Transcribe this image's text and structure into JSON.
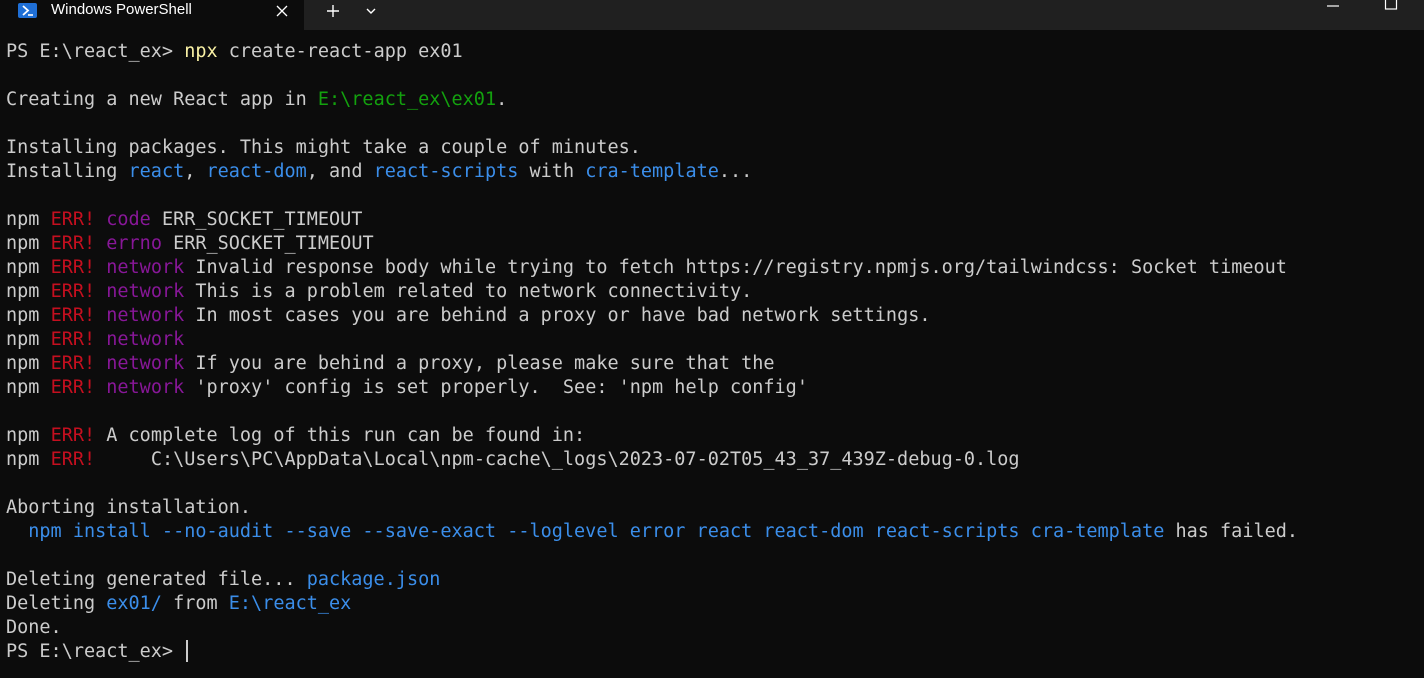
{
  "window": {
    "tab_title": "Windows PowerShell",
    "new_tab_icon": "plus-icon",
    "dropdown_icon": "chevron-down-icon",
    "close_icon": "close-icon"
  },
  "colors": {
    "background": "#0c0c0c",
    "text": "#cccccc",
    "yellow": "#f9f1a5",
    "green": "#13a10e",
    "blue": "#3b8eea",
    "red": "#c50f1f",
    "magenta": "#881798"
  },
  "terminal": {
    "lines": [
      {
        "segs": [
          {
            "t": "PS E:\\react_ex> ",
            "c": ""
          },
          {
            "t": "npx",
            "c": "yellow"
          },
          {
            "t": " create-react-app ex01",
            "c": ""
          }
        ]
      },
      {
        "segs": []
      },
      {
        "segs": [
          {
            "t": "Creating a new React app in ",
            "c": ""
          },
          {
            "t": "E:\\react_ex\\ex01",
            "c": "green"
          },
          {
            "t": ".",
            "c": ""
          }
        ]
      },
      {
        "segs": []
      },
      {
        "segs": [
          {
            "t": "Installing packages. This might take a couple of minutes.",
            "c": ""
          }
        ]
      },
      {
        "segs": [
          {
            "t": "Installing ",
            "c": ""
          },
          {
            "t": "react",
            "c": "blue"
          },
          {
            "t": ", ",
            "c": ""
          },
          {
            "t": "react-dom",
            "c": "blue"
          },
          {
            "t": ", and ",
            "c": ""
          },
          {
            "t": "react-scripts",
            "c": "blue"
          },
          {
            "t": " with ",
            "c": ""
          },
          {
            "t": "cra-template",
            "c": "blue"
          },
          {
            "t": "...",
            "c": ""
          }
        ]
      },
      {
        "segs": []
      },
      {
        "segs": [
          {
            "t": "npm ",
            "c": ""
          },
          {
            "t": "ERR!",
            "c": "red"
          },
          {
            "t": " ",
            "c": ""
          },
          {
            "t": "code",
            "c": "magenta"
          },
          {
            "t": " ERR_SOCKET_TIMEOUT",
            "c": ""
          }
        ]
      },
      {
        "segs": [
          {
            "t": "npm ",
            "c": ""
          },
          {
            "t": "ERR!",
            "c": "red"
          },
          {
            "t": " ",
            "c": ""
          },
          {
            "t": "errno",
            "c": "magenta"
          },
          {
            "t": " ERR_SOCKET_TIMEOUT",
            "c": ""
          }
        ]
      },
      {
        "segs": [
          {
            "t": "npm ",
            "c": ""
          },
          {
            "t": "ERR!",
            "c": "red"
          },
          {
            "t": " ",
            "c": ""
          },
          {
            "t": "network",
            "c": "magenta"
          },
          {
            "t": " Invalid response body while trying to fetch https://registry.npmjs.org/tailwindcss: Socket timeout",
            "c": ""
          }
        ]
      },
      {
        "segs": [
          {
            "t": "npm ",
            "c": ""
          },
          {
            "t": "ERR!",
            "c": "red"
          },
          {
            "t": " ",
            "c": ""
          },
          {
            "t": "network",
            "c": "magenta"
          },
          {
            "t": " This is a problem related to network connectivity.",
            "c": ""
          }
        ]
      },
      {
        "segs": [
          {
            "t": "npm ",
            "c": ""
          },
          {
            "t": "ERR!",
            "c": "red"
          },
          {
            "t": " ",
            "c": ""
          },
          {
            "t": "network",
            "c": "magenta"
          },
          {
            "t": " In most cases you are behind a proxy or have bad network settings.",
            "c": ""
          }
        ]
      },
      {
        "segs": [
          {
            "t": "npm ",
            "c": ""
          },
          {
            "t": "ERR!",
            "c": "red"
          },
          {
            "t": " ",
            "c": ""
          },
          {
            "t": "network",
            "c": "magenta"
          }
        ]
      },
      {
        "segs": [
          {
            "t": "npm ",
            "c": ""
          },
          {
            "t": "ERR!",
            "c": "red"
          },
          {
            "t": " ",
            "c": ""
          },
          {
            "t": "network",
            "c": "magenta"
          },
          {
            "t": " If you are behind a proxy, please make sure that the",
            "c": ""
          }
        ]
      },
      {
        "segs": [
          {
            "t": "npm ",
            "c": ""
          },
          {
            "t": "ERR!",
            "c": "red"
          },
          {
            "t": " ",
            "c": ""
          },
          {
            "t": "network",
            "c": "magenta"
          },
          {
            "t": " 'proxy' config is set properly.  See: 'npm help config'",
            "c": ""
          }
        ]
      },
      {
        "segs": []
      },
      {
        "segs": [
          {
            "t": "npm ",
            "c": ""
          },
          {
            "t": "ERR!",
            "c": "red"
          },
          {
            "t": " A complete log of this run can be found in:",
            "c": ""
          }
        ]
      },
      {
        "segs": [
          {
            "t": "npm ",
            "c": ""
          },
          {
            "t": "ERR!",
            "c": "red"
          },
          {
            "t": "     C:\\Users\\PC\\AppData\\Local\\npm-cache\\_logs\\2023-07-02T05_43_37_439Z-debug-0.log",
            "c": ""
          }
        ]
      },
      {
        "segs": []
      },
      {
        "segs": [
          {
            "t": "Aborting installation.",
            "c": ""
          }
        ]
      },
      {
        "segs": [
          {
            "t": "  ",
            "c": ""
          },
          {
            "t": "npm install --no-audit --save --save-exact --loglevel error react react-dom react-scripts cra-template",
            "c": "blue"
          },
          {
            "t": " has failed.",
            "c": ""
          }
        ]
      },
      {
        "segs": []
      },
      {
        "segs": [
          {
            "t": "Deleting generated file... ",
            "c": ""
          },
          {
            "t": "package.json",
            "c": "blue"
          }
        ]
      },
      {
        "segs": [
          {
            "t": "Deleting ",
            "c": ""
          },
          {
            "t": "ex01/",
            "c": "blue"
          },
          {
            "t": " from ",
            "c": ""
          },
          {
            "t": "E:\\react_ex",
            "c": "blue"
          }
        ]
      },
      {
        "segs": [
          {
            "t": "Done.",
            "c": ""
          }
        ]
      },
      {
        "segs": [
          {
            "t": "PS E:\\react_ex> ",
            "c": ""
          }
        ],
        "cursor": true
      }
    ]
  }
}
